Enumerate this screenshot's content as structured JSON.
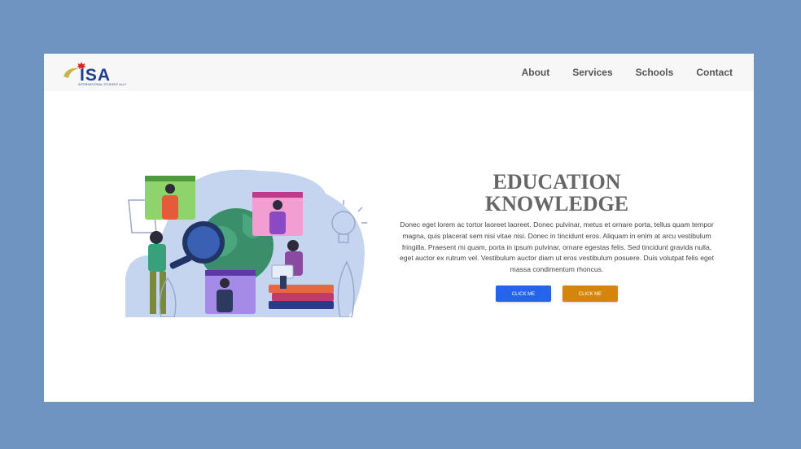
{
  "logo": {
    "text": "ISA",
    "subtitle": "INTERNATIONAL STUDENT ALLY"
  },
  "nav": {
    "items": [
      {
        "label": "About"
      },
      {
        "label": "Services"
      },
      {
        "label": "Schools"
      },
      {
        "label": "Contact"
      }
    ]
  },
  "hero": {
    "illustration": "education-knowledge-illustration"
  },
  "content": {
    "title_line1": "EDUCATION",
    "title_line2": "KNOWLEDGE",
    "description": "Donec eget lorem ac tortor laoreet laoreet. Donec pulvinar, metus et ornare porta, tellus quam tempor magna, quis placerat sem nisi vitae nisi. Donec in tincidunt eros. Aliquam in enim at arcu vestibulum fringilla. Praesent mi quam, porta in ipsum pulvinar, ornare egestas felis. Sed tincidunt gravida nulla, eget auctor ex rutrum vel. Vestibulum auctor diam ut eros vestibulum posuere. Duis volutpat felis eget massa condimentum rhoncus.",
    "buttons": [
      {
        "label": "CLICK ME",
        "color": "#2563eb"
      },
      {
        "label": "CLICK ME",
        "color": "#d4860b"
      }
    ]
  },
  "colors": {
    "background": "#6f93c0",
    "navbar": "#f7f7f7",
    "page": "#ffffff",
    "brand": "#1f3f8f"
  }
}
